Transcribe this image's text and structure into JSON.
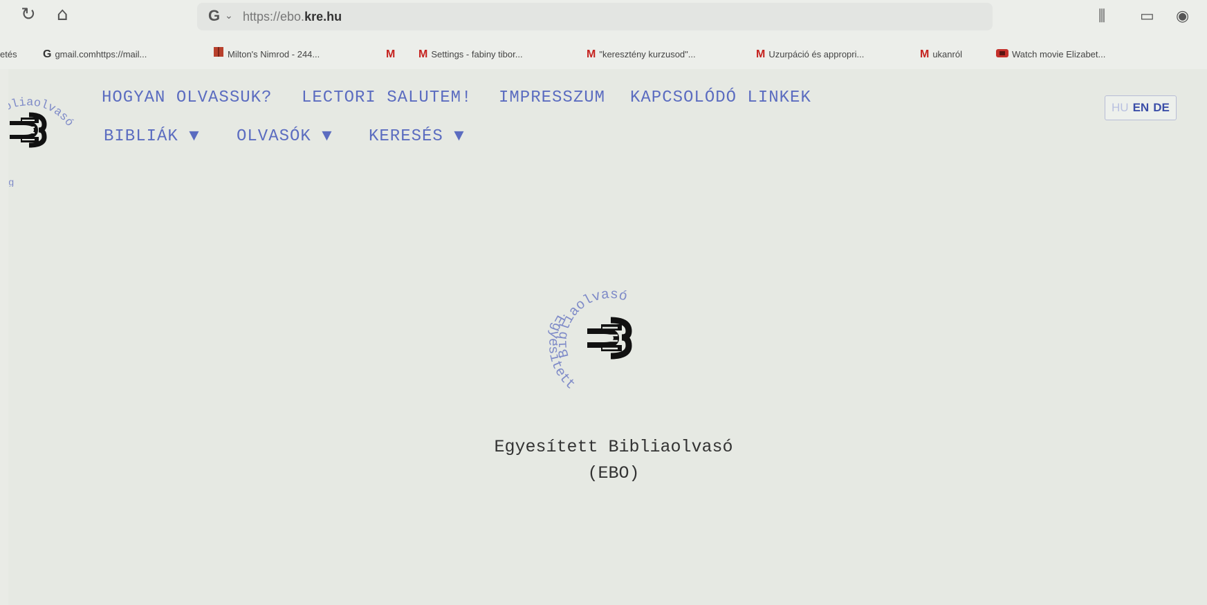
{
  "browser": {
    "url_prefix": "https://ebo.",
    "url_domain": "kre.hu",
    "bookmarks": [
      {
        "icon": "G",
        "label": "gmail.comhttps://mail..."
      },
      {
        "icon": "book-icon",
        "label": "Milton's Nimrod - 244..."
      },
      {
        "icon": "M",
        "label": ""
      },
      {
        "icon": "M",
        "label": "Settings - fabiny tibor..."
      },
      {
        "icon": "M",
        "label": "\"keresztény kurzusod\"..."
      },
      {
        "icon": "M",
        "label": "Uzurpáció és appropri..."
      },
      {
        "icon": "M",
        "label": "ukanról"
      },
      {
        "icon": "video-icon",
        "label": "Watch movie Elizabet..."
      }
    ],
    "bookmark_partial": "etés"
  },
  "site": {
    "logo_text": "Bibliaolvasó",
    "logo_text_bottom": "Egyesített",
    "nav": [
      {
        "label": "HOGYAN OLVASSUK?"
      },
      {
        "label": "LECTORI SALUTEM!"
      },
      {
        "label": "IMPRESSZUM"
      },
      {
        "label": "KAPCSOLÓDÓ LINKEK"
      }
    ],
    "dropdowns": [
      {
        "label": "BIBLIÁK ▼"
      },
      {
        "label": "OLVASÓK ▼"
      },
      {
        "label": "KERESÉS ▼"
      }
    ],
    "languages": [
      {
        "code": "HU",
        "active": false
      },
      {
        "code": "EN",
        "active": true
      },
      {
        "code": "DE",
        "active": true
      }
    ],
    "title": "Egyesített Bibliaolvasó",
    "subtitle": "(EBO)",
    "colors": {
      "nav": "#5b6cc0",
      "ring_text": "#7f8bc8",
      "logo": "#111111"
    }
  }
}
